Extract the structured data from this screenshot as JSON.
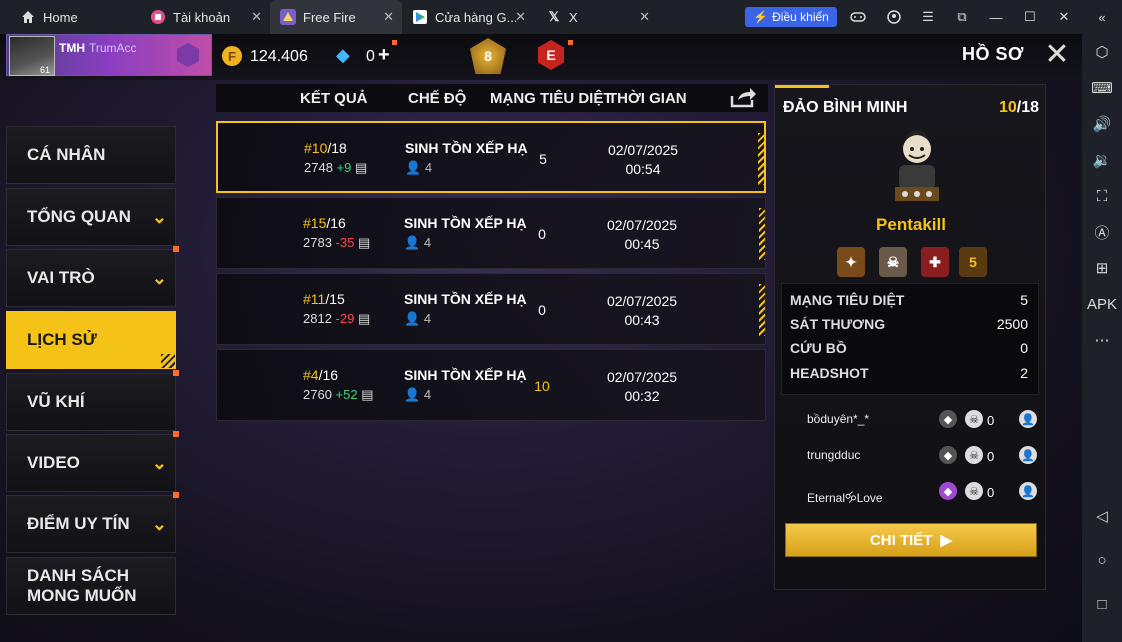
{
  "browser": {
    "tabs": [
      {
        "label": "Home",
        "icon": "home-icon"
      },
      {
        "label": "Tài khoản",
        "icon": "account-app-icon"
      },
      {
        "label": "Free Fire",
        "icon": "free-fire-app-icon"
      },
      {
        "label": "Cửa hàng G...",
        "icon": "play-store-icon"
      },
      {
        "label": "X",
        "icon": "x-app-icon"
      }
    ],
    "control_button": "Điều khiển"
  },
  "header": {
    "player_tag": "TMH",
    "player_name": "TrumAcc",
    "avatar_level": "61",
    "gold": "124.406",
    "diamonds": "0",
    "br_rank_number": "8",
    "cs_rank_letter": "E",
    "title": "HỒ SƠ"
  },
  "menu": {
    "items": [
      {
        "label": "CÁ NHÂN",
        "chevron": false,
        "dot": false,
        "selected": false
      },
      {
        "label": "TỔNG QUAN",
        "chevron": true,
        "dot": false,
        "selected": false
      },
      {
        "label": "VAI TRÒ",
        "chevron": true,
        "dot": true,
        "selected": false
      },
      {
        "label": "LỊCH SỬ",
        "chevron": false,
        "dot": false,
        "selected": true
      },
      {
        "label": "VŨ KHÍ",
        "chevron": false,
        "dot": true,
        "selected": false
      },
      {
        "label": "VIDEO",
        "chevron": true,
        "dot": true,
        "selected": false
      },
      {
        "label": "ĐIỂM UY TÍN",
        "chevron": true,
        "dot": true,
        "selected": false
      },
      {
        "label": "DANH SÁCH MONG MUỐN",
        "chevron": false,
        "dot": false,
        "selected": false
      }
    ]
  },
  "table": {
    "headers": [
      "KẾT QUẢ",
      "CHẾ ĐỘ",
      "MẠNG TIÊU DIỆT",
      "THỜI GIAN"
    ],
    "rows": [
      {
        "rank": "#10",
        "total": "/18",
        "points": "2748",
        "delta": "+9",
        "delta_sign": "pos",
        "mode": "SINH TỒN XẾP HẠ",
        "party": "4",
        "kills": "5",
        "kills_gold": false,
        "date": "02/07/2025",
        "time": "00:54",
        "selected": true
      },
      {
        "rank": "#15",
        "total": "/16",
        "points": "2783",
        "delta": "-35",
        "delta_sign": "neg",
        "mode": "SINH TỒN XẾP HẠ",
        "party": "4",
        "kills": "0",
        "kills_gold": false,
        "date": "02/07/2025",
        "time": "00:45",
        "selected": false
      },
      {
        "rank": "#11",
        "total": "/15",
        "points": "2812",
        "delta": "-29",
        "delta_sign": "neg",
        "mode": "SINH TỒN XẾP HẠ",
        "party": "4",
        "kills": "0",
        "kills_gold": false,
        "date": "02/07/2025",
        "time": "00:43",
        "selected": false
      },
      {
        "rank": "#4",
        "total": "/16",
        "points": "2760",
        "delta": "+52",
        "delta_sign": "pos",
        "mode": "SINH TỒN XẾP HẠ",
        "party": "4",
        "kills": "10",
        "kills_gold": true,
        "date": "02/07/2025",
        "time": "00:32",
        "selected": false
      }
    ]
  },
  "detail": {
    "map": "ĐẢO BÌNH MINH",
    "placement": "10",
    "placement_total": "/18",
    "award": "Pentakill",
    "medals": [
      "5"
    ],
    "stats": [
      {
        "label": "MẠNG TIÊU DIỆT",
        "value": "5"
      },
      {
        "label": "SÁT THƯƠNG",
        "value": "2500"
      },
      {
        "label": "CỨU BỒ",
        "value": "0"
      },
      {
        "label": "HEADSHOT",
        "value": "2"
      }
    ],
    "teammates": [
      {
        "name": "bồduyên*_*",
        "kills": "0"
      },
      {
        "name": "trungdduc",
        "kills": "0"
      },
      {
        "name": "Eternal🝰Love",
        "kills": "0"
      }
    ],
    "detail_button": "CHI TIẾT"
  },
  "colors": {
    "accent": "#f5c318",
    "positive": "#3fd27a",
    "negative": "#ff4a4a",
    "browser_active": "#3b64e6"
  }
}
